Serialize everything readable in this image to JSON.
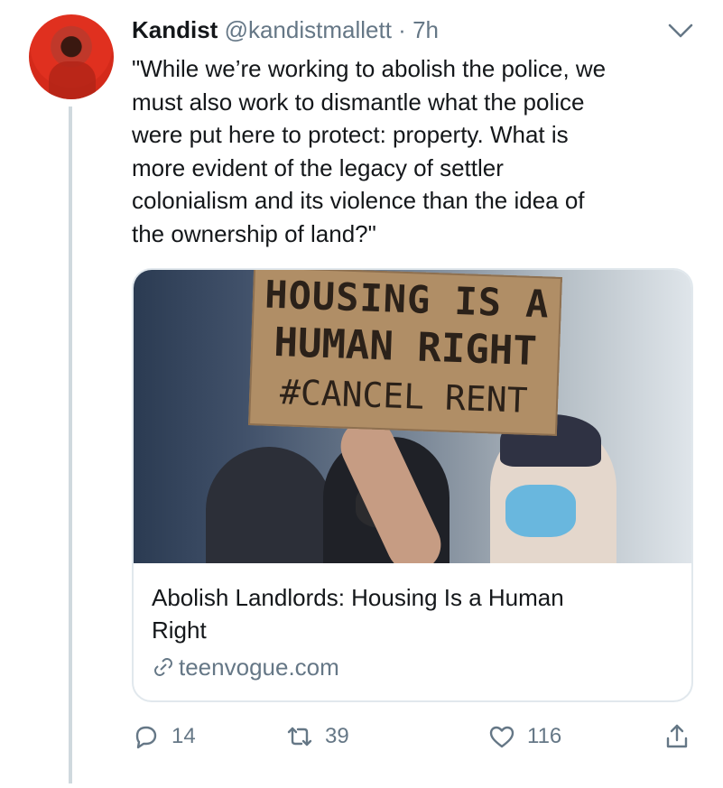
{
  "tweet": {
    "name": "Kandist",
    "handle": "@kandistmallett",
    "separator": "·",
    "time": "7h",
    "text_lines": [
      "\"While we’re working to abolish the police, we",
      "must also work to dismantle what the police",
      "were put here to protect: property. What is",
      "more evident of the legacy of settler",
      "colonialism and its violence than the idea of",
      "the ownership of land?\""
    ]
  },
  "card": {
    "sign_lines": [
      "HOUSING IS A",
      "HUMAN RIGHT",
      "#CANCEL RENT"
    ],
    "title_lines": [
      "Abolish Landlords: Housing Is a Human",
      "Right"
    ],
    "domain": "teenvogue.com"
  },
  "actions": {
    "replies": "14",
    "retweets": "39",
    "likes": "116"
  },
  "colors": {
    "thread_line": "#cfd9de",
    "secondary_text": "#657786",
    "primary_text": "#14171a",
    "card_border": "#e1e8ed"
  },
  "icons": [
    "caret-down-icon",
    "link-icon",
    "reply-icon",
    "retweet-icon",
    "like-icon",
    "share-icon"
  ]
}
